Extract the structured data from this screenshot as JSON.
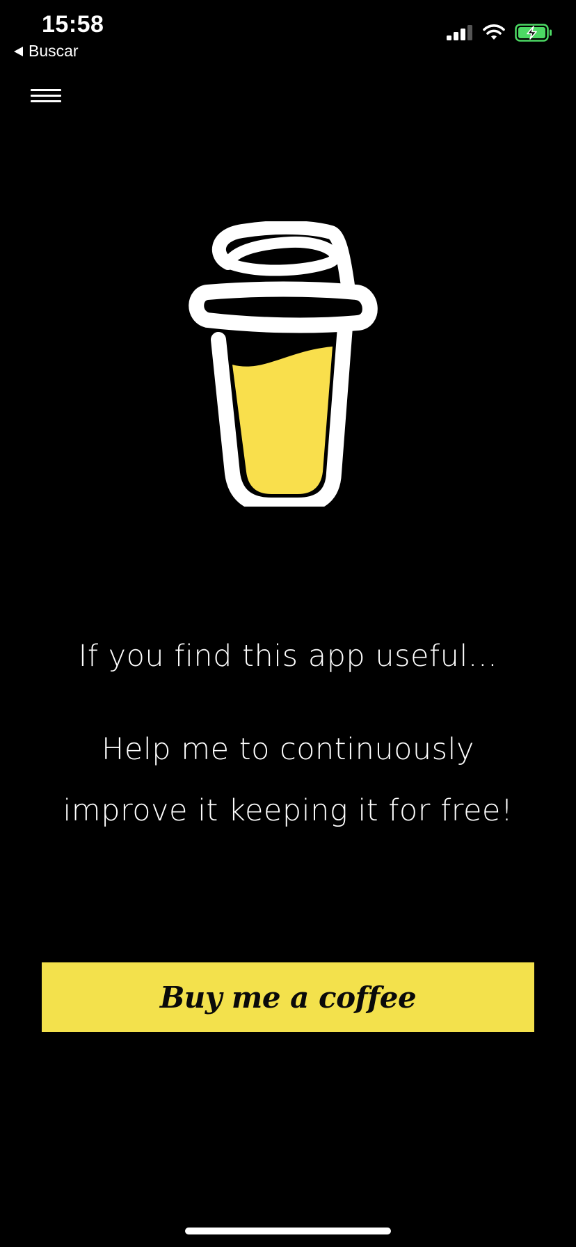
{
  "status_bar": {
    "time": "15:58",
    "back_label": "Buscar",
    "icons": [
      "signal-icon",
      "wifi-icon",
      "battery-charging-icon"
    ],
    "battery_color": "#4cd964"
  },
  "header": {
    "menu_icon": "hamburger-menu-icon"
  },
  "main": {
    "logo_icon": "coffee-cup-icon",
    "line1": "If you find this app useful...",
    "line2": "Help me to continuously",
    "line3": "improve it keeping it for free!",
    "button_label": "Buy me a coffee"
  },
  "colors": {
    "background": "#000000",
    "accent": "#f3e14c",
    "coffee_fill": "#f9df4c",
    "text": "#ffffff"
  }
}
